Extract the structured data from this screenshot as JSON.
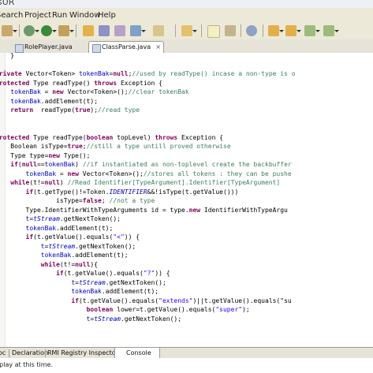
{
  "window": {
    "title": "sUR"
  },
  "menu": [
    "Search",
    "Project",
    "Run",
    "Window",
    "Help"
  ],
  "toolbar_icons": [
    "build-icon",
    "run-icon",
    "debug-icon",
    "new-package-icon",
    "new-class-icon",
    "open-type-icon",
    "search-icon",
    "refactor-icon",
    "toggle-mark-icon",
    "perspective-icon",
    "next-annotation-icon",
    "prev-annotation-icon",
    "back-icon",
    "forward-icon"
  ],
  "tabs": [
    {
      "label": "RolePlayer.java",
      "active": false
    },
    {
      "label": "ClassParse.java",
      "active": true,
      "close": "×"
    }
  ],
  "code_lines": [
    [
      {
        "t": "    }"
      }
    ],
    [],
    [
      {
        "t": "private ",
        "c": "k"
      },
      {
        "t": "Vector<Token> "
      },
      {
        "t": "tokenBak",
        "c": "f"
      },
      {
        "t": "="
      },
      {
        "t": "null",
        "c": "k"
      },
      {
        "t": ";"
      },
      {
        "t": "//used by readType() incase a non-type is o",
        "c": "c"
      }
    ],
    [
      {
        "t": "protected ",
        "c": "k"
      },
      {
        "t": "Type readType() "
      },
      {
        "t": "throws ",
        "c": "k"
      },
      {
        "t": "Exception {"
      }
    ],
    [
      {
        "t": "    "
      },
      {
        "t": "tokenBak",
        "c": "f"
      },
      {
        "t": " = "
      },
      {
        "t": "new ",
        "c": "k"
      },
      {
        "t": "Vector<Token>();"
      },
      {
        "t": "//clear tokenBak",
        "c": "c"
      }
    ],
    [
      {
        "t": "    "
      },
      {
        "t": "tokenBak",
        "c": "f"
      },
      {
        "t": ".addElement(t);"
      }
    ],
    [
      {
        "t": "    "
      },
      {
        "t": "return ",
        "c": "k"
      },
      {
        "t": " readType("
      },
      {
        "t": "true",
        "c": "k"
      },
      {
        "t": ");"
      },
      {
        "t": "//read type",
        "c": "c"
      }
    ],
    [
      {
        "t": "}"
      }
    ],
    [],
    [
      {
        "t": "protected ",
        "c": "k"
      },
      {
        "t": "Type readType("
      },
      {
        "t": "boolean ",
        "c": "k"
      },
      {
        "t": "topLevel) "
      },
      {
        "t": "throws ",
        "c": "k"
      },
      {
        "t": "Exception {"
      }
    ],
    [
      {
        "t": "    Boolean isType="
      },
      {
        "t": "true",
        "c": "k"
      },
      {
        "t": ";"
      },
      {
        "t": "//still a type untill proved otherwise",
        "c": "c"
      }
    ],
    [
      {
        "t": "    Type type="
      },
      {
        "t": "new ",
        "c": "k"
      },
      {
        "t": "Type();"
      }
    ],
    [
      {
        "t": "    "
      },
      {
        "t": "if",
        "c": "k"
      },
      {
        "t": "("
      },
      {
        "t": "null",
        "c": "k"
      },
      {
        "t": "=="
      },
      {
        "t": "tokenBak",
        "c": "f"
      },
      {
        "t": ") "
      },
      {
        "t": "//if instantiated as non-toplevel create the backbuffer",
        "c": "c"
      }
    ],
    [
      {
        "t": "        "
      },
      {
        "t": "tokenBak",
        "c": "f"
      },
      {
        "t": " = "
      },
      {
        "t": "new ",
        "c": "k"
      },
      {
        "t": "Vector<Token>();"
      },
      {
        "t": "//stores all tokens : they can be pushe",
        "c": "c"
      }
    ],
    [
      {
        "t": "    "
      },
      {
        "t": "while",
        "c": "k"
      },
      {
        "t": "(t!="
      },
      {
        "t": "null",
        "c": "k"
      },
      {
        "t": ") "
      },
      {
        "t": "//Read Identifier[TypeArgument].Identifier[TypeArgument]",
        "c": "c"
      }
    ],
    [
      {
        "t": "        "
      },
      {
        "t": "if",
        "c": "k"
      },
      {
        "t": "(t.getType()!=Token."
      },
      {
        "t": "IDENTIFIER",
        "c": "f i"
      },
      {
        "t": "&&!isType(t.getValue()))"
      }
    ],
    [
      {
        "t": "                isType="
      },
      {
        "t": "false",
        "c": "k"
      },
      {
        "t": "; "
      },
      {
        "t": "//not a type",
        "c": "c"
      }
    ],
    [
      {
        "t": "        Type.IdentifierWithTypeArguments id = type."
      },
      {
        "t": "new ",
        "c": "k"
      },
      {
        "t": "IdentifierWithTypeArgu"
      }
    ],
    [
      {
        "t": "        "
      },
      {
        "t": "t",
        "c": "f"
      },
      {
        "t": "="
      },
      {
        "t": "tStream",
        "c": "f i"
      },
      {
        "t": ".getNextToken();"
      }
    ],
    [
      {
        "t": "        "
      },
      {
        "t": "tokenBak",
        "c": "f"
      },
      {
        "t": ".addElement(t);"
      }
    ],
    [
      {
        "t": "        "
      },
      {
        "t": "if",
        "c": "k"
      },
      {
        "t": "(t.getValue().equals("
      },
      {
        "t": "\"<\"",
        "c": "s"
      },
      {
        "t": ")) {"
      }
    ],
    [
      {
        "t": "            "
      },
      {
        "t": "t",
        "c": "f"
      },
      {
        "t": "="
      },
      {
        "t": "tStream",
        "c": "f i"
      },
      {
        "t": ".getNextToken();"
      }
    ],
    [
      {
        "t": "            "
      },
      {
        "t": "tokenBak",
        "c": "f"
      },
      {
        "t": ".addElement(t);"
      }
    ],
    [
      {
        "t": "            "
      },
      {
        "t": "while",
        "c": "k"
      },
      {
        "t": "(t!="
      },
      {
        "t": "null",
        "c": "k"
      },
      {
        "t": "){"
      }
    ],
    [
      {
        "t": "                "
      },
      {
        "t": "if",
        "c": "k"
      },
      {
        "t": "(t.getValue().equals("
      },
      {
        "t": "\"?\"",
        "c": "s"
      },
      {
        "t": ")) {"
      }
    ],
    [
      {
        "t": "                    "
      },
      {
        "t": "t",
        "c": "f"
      },
      {
        "t": "="
      },
      {
        "t": "tStream",
        "c": "f i"
      },
      {
        "t": ".getNextToken();"
      }
    ],
    [
      {
        "t": "                    "
      },
      {
        "t": "tokenBak",
        "c": "f"
      },
      {
        "t": ".addElement(t);"
      }
    ],
    [
      {
        "t": "                    "
      },
      {
        "t": "if",
        "c": "k"
      },
      {
        "t": "(t.getValue().equals("
      },
      {
        "t": "\"extends\"",
        "c": "s"
      },
      {
        "t": ")||t.getValue().equals(\"su"
      }
    ],
    [
      {
        "t": "                        "
      },
      {
        "t": "boolean ",
        "c": "k"
      },
      {
        "t": "lower=t.getValue().equals("
      },
      {
        "t": "\"super\"",
        "c": "s"
      },
      {
        "t": ");"
      }
    ],
    [
      {
        "t": "                        "
      },
      {
        "t": "t",
        "c": "f"
      },
      {
        "t": "="
      },
      {
        "t": "tStream",
        "c": "f i"
      },
      {
        "t": ".getNextToken();"
      }
    ]
  ],
  "bottom_tabs": [
    "oc",
    "Declaration",
    "RMI Registry Inspector",
    "Console"
  ],
  "status": {
    "text": "splay at this time."
  }
}
